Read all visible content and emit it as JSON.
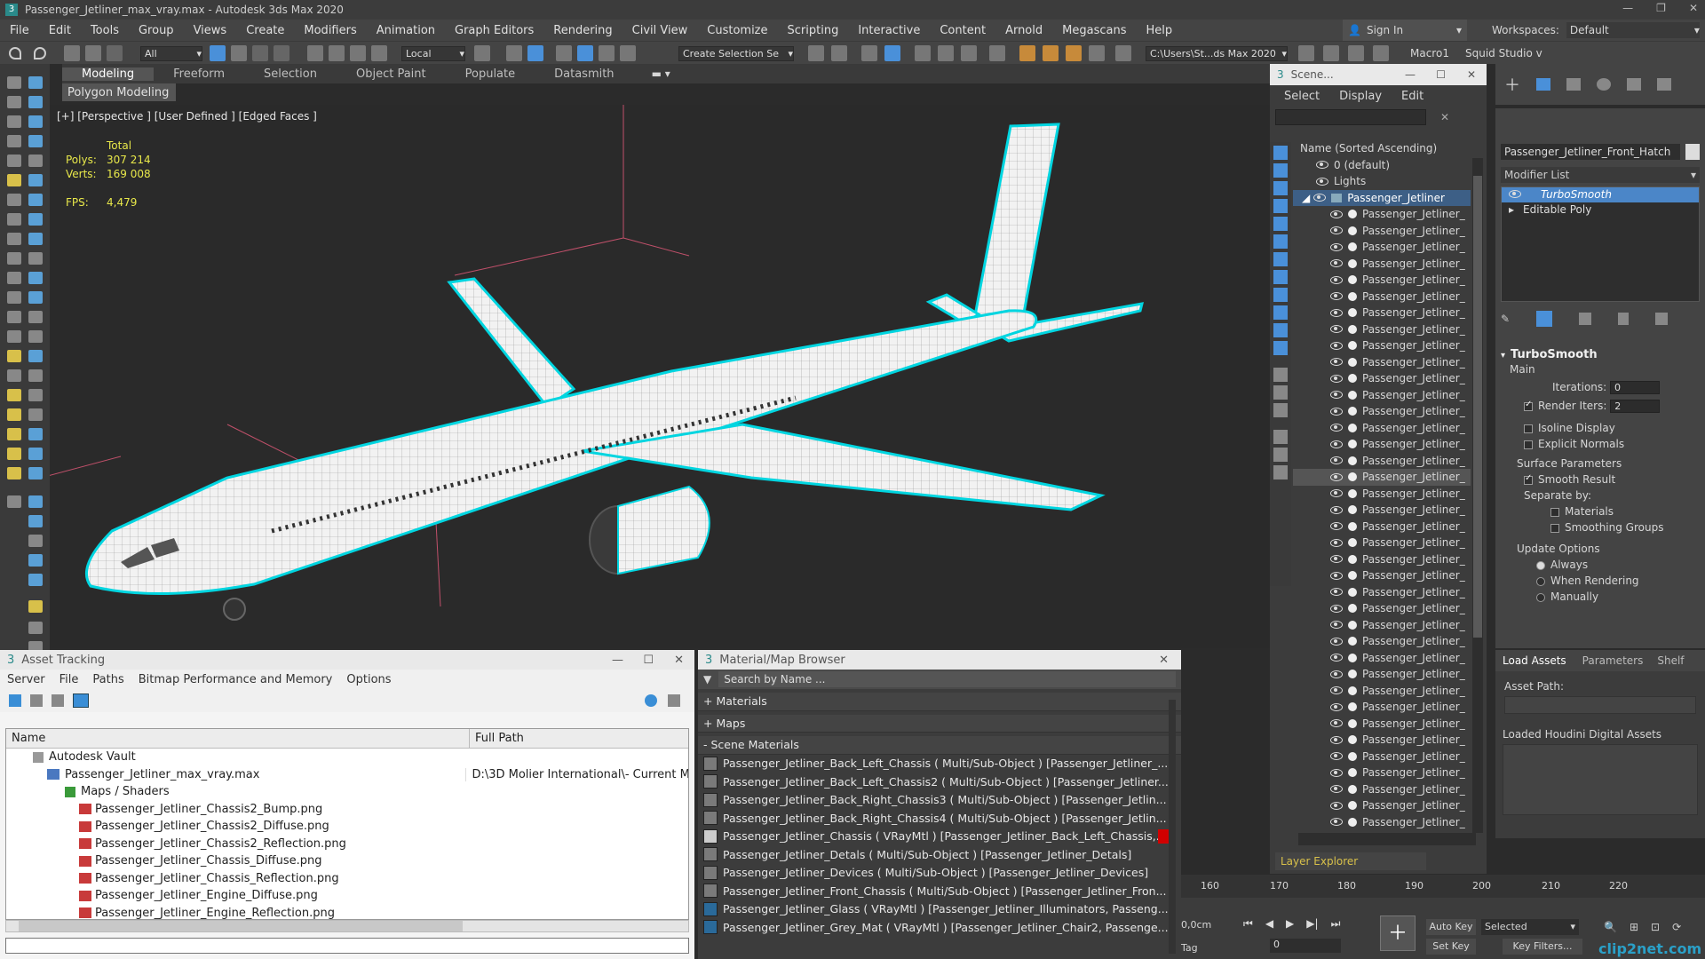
{
  "title_bar": {
    "title": "Passenger_Jetliner_max_vray.max - Autodesk 3ds Max 2020"
  },
  "menu": [
    "File",
    "Edit",
    "Tools",
    "Group",
    "Views",
    "Create",
    "Modifiers",
    "Animation",
    "Graph Editors",
    "Rendering",
    "Civil View",
    "Customize",
    "Scripting",
    "Interactive",
    "Content",
    "Arnold",
    "Megascans",
    "Help"
  ],
  "signin": "Sign In",
  "workspaces": {
    "label": "Workspaces:",
    "value": "Default"
  },
  "toolbar": {
    "filter": "All",
    "coord": "Local",
    "selection_set": "Create Selection Se",
    "path": "C:\\Users\\St...ds Max 2020",
    "macro": "Macro1",
    "studio": "Squid Studio v"
  },
  "ribbon": {
    "tabs": [
      "Modeling",
      "Freeform",
      "Selection",
      "Object Paint",
      "Populate",
      "Datasmith"
    ],
    "subtab": "Polygon Modeling"
  },
  "viewport": {
    "label": "[+] [Perspective ] [User Defined ] [Edged Faces ]",
    "total": "Total",
    "polys_label": "Polys:",
    "polys": "307 214",
    "verts_label": "Verts:",
    "verts": "169 008",
    "fps_label": "FPS:",
    "fps": "4,479"
  },
  "asset_tracking": {
    "title": "Asset Tracking",
    "menu": [
      "Server",
      "File",
      "Paths",
      "Bitmap Performance and Memory",
      "Options"
    ],
    "col_name": "Name",
    "col_path": "Full Path",
    "vault": "Autodesk Vault",
    "file": "Passenger_Jetliner_max_vray.max",
    "file_path": "D:\\3D Molier International\\- Current M",
    "maps_folder": "Maps / Shaders",
    "maps": [
      "Passenger_Jetliner_Chassis2_Bump.png",
      "Passenger_Jetliner_Chassis2_Diffuse.png",
      "Passenger_Jetliner_Chassis2_Reflection.png",
      "Passenger_Jetliner_Chassis_Diffuse.png",
      "Passenger_Jetliner_Chassis_Reflection.png",
      "Passenger_Jetliner_Engine_Diffuse.png",
      "Passenger_Jetliner_Engine_Reflection.png"
    ]
  },
  "material_browser": {
    "title": "Material/Map Browser",
    "search": "Search by Name ...",
    "materials": "+ Materials",
    "maps": "+ Maps",
    "scene": "- Scene Materials",
    "items": [
      "Passenger_Jetliner_Back_Left_Chassis ( Multi/Sub-Object ) [Passenger_Jetliner_...",
      "Passenger_Jetliner_Back_Left_Chassis2 ( Multi/Sub-Object ) [Passenger_Jetliner...",
      "Passenger_Jetliner_Back_Right_Chassis3 ( Multi/Sub-Object ) [Passenger_Jetlin...",
      "Passenger_Jetliner_Back_Right_Chassis4 ( Multi/Sub-Object ) [Passenger_Jetlin...",
      "Passenger_Jetliner_Chassis ( VRayMtl ) [Passenger_Jetliner_Back_Left_Chassis,...",
      "Passenger_Jetliner_Detals ( Multi/Sub-Object ) [Passenger_Jetliner_Detals]",
      "Passenger_Jetliner_Devices ( Multi/Sub-Object ) [Passenger_Jetliner_Devices]",
      "Passenger_Jetliner_Front_Chassis ( Multi/Sub-Object ) [Passenger_Jetliner_Fron...",
      "Passenger_Jetliner_Glass ( VRayMtl ) [Passenger_Jetliner_Illuminators, Passeng...",
      "Passenger_Jetliner_Grey_Mat ( VRayMtl ) [Passenger_Jetliner_Chair2, Passenge..."
    ]
  },
  "scene_explorer": {
    "title": "Scene...",
    "menu": [
      "Select",
      "Display",
      "Edit"
    ],
    "header": "Name (Sorted Ascending)",
    "rows": [
      "0 (default)",
      "Lights",
      "Passenger_Jetliner"
    ],
    "child": "Passenger_Jetliner_",
    "child_count": 38,
    "footer": "Layer Explorer"
  },
  "command_panel": {
    "object_name": "Passenger_Jetliner_Front_Hatch",
    "modifier_list": "Modifier List",
    "stack": [
      "TurboSmooth",
      "Editable Poly"
    ],
    "rollout": "TurboSmooth",
    "main": "Main",
    "iterations_label": "Iterations:",
    "iterations": "0",
    "render_iters_label": "Render Iters:",
    "render_iters": "2",
    "isoline": "Isoline Display",
    "explicit": "Explicit Normals",
    "surface": "Surface Parameters",
    "smooth_result": "Smooth Result",
    "separate": "Separate by:",
    "materials": "Materials",
    "smoothing": "Smoothing Groups",
    "update": "Update Options",
    "always": "Always",
    "when_rendering": "When Rendering",
    "manually": "Manually",
    "tabs": [
      "Load Assets",
      "Parameters",
      "Shelf"
    ],
    "asset_path": "Asset Path:",
    "houdini": "Loaded Houdini Digital Assets"
  },
  "timeline": {
    "ticks": [
      "160",
      "170",
      "180",
      "190",
      "200",
      "210",
      "220"
    ],
    "pos": "0,0cm",
    "tag": "Tag",
    "auto_key": "Auto Key",
    "selected": "Selected",
    "set_key": "Set Key",
    "key_filters": "Key Filters...",
    "frame": "0",
    "watermark": "clip2net.com"
  }
}
